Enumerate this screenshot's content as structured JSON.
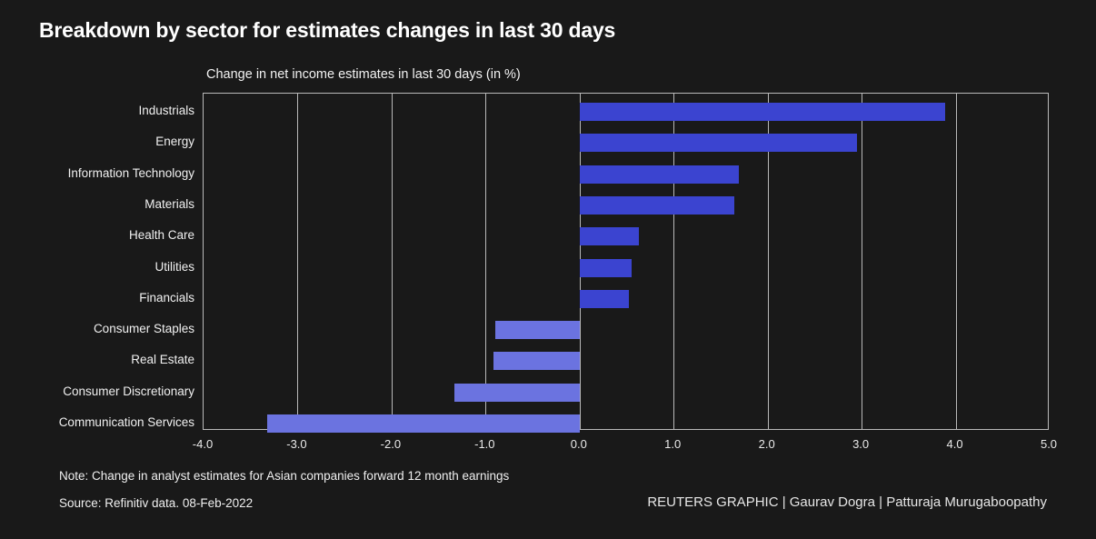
{
  "title": "Breakdown by sector for estimates changes in last 30 days",
  "subtitle": "Change in net income estimates in last 30 days (in %)",
  "footer": {
    "note": "Note: Change in analyst estimates for Asian companies forward 12 month earnings",
    "source": "Source: Refinitiv data.  08-Feb-2022",
    "credit": "REUTERS GRAPHIC | Gaurav Dogra | Patturaja Murugaboopathy"
  },
  "colors": {
    "background": "#191919",
    "positive_bar": "#3b44d0",
    "negative_bar": "#6b73e0",
    "axis": "#b9b9b9",
    "text": "#ffffff"
  },
  "chart_data": {
    "type": "bar",
    "orientation": "horizontal",
    "title": "Breakdown by sector for estimates changes in last 30 days",
    "subtitle": "Change in net income estimates in last 30 days (in %)",
    "xlabel": "",
    "ylabel": "",
    "xlim": [
      -4.0,
      5.0
    ],
    "xticks": [
      "-4.0",
      "-3.0",
      "-2.0",
      "-1.0",
      "0.0",
      "1.0",
      "2.0",
      "3.0",
      "4.0",
      "5.0"
    ],
    "xtick_values": [
      -4.0,
      -3.0,
      -2.0,
      -1.0,
      0.0,
      1.0,
      2.0,
      3.0,
      4.0,
      5.0
    ],
    "grid": true,
    "legend": "none",
    "categories": [
      "Industrials",
      "Energy",
      "Information Technology",
      "Materials",
      "Health Care",
      "Utilities",
      "Financials",
      "Consumer Staples",
      "Real Estate",
      "Consumer Discretionary",
      "Communication Services"
    ],
    "values": [
      3.89,
      2.95,
      1.69,
      1.65,
      0.63,
      0.55,
      0.52,
      -0.9,
      -0.92,
      -1.33,
      -3.32
    ]
  }
}
